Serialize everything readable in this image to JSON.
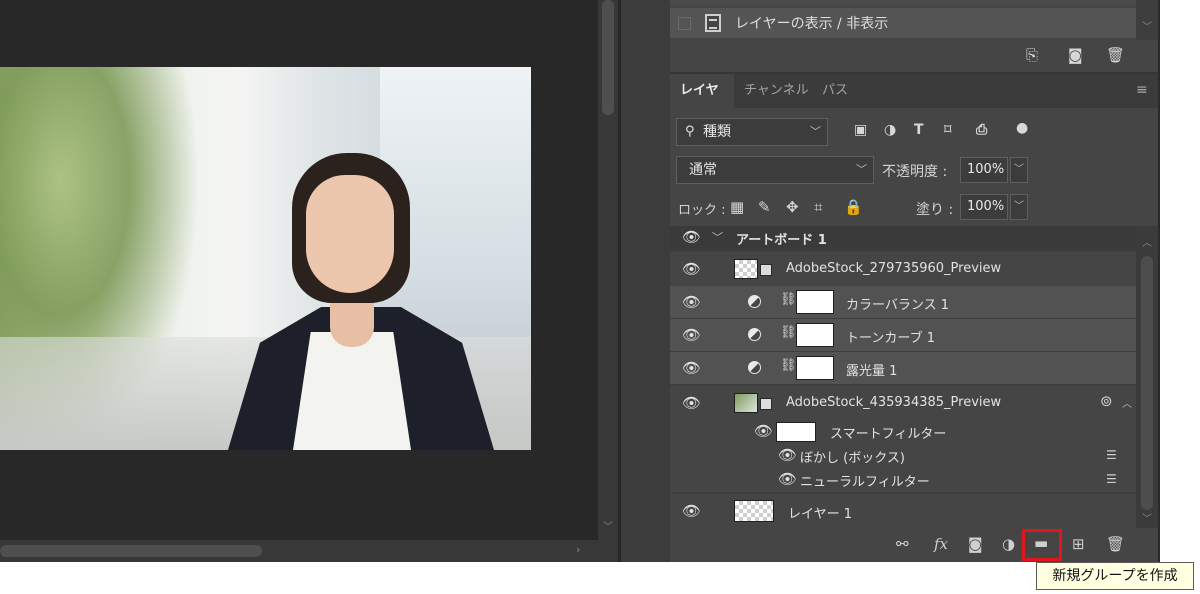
{
  "history": {
    "step_label": "レイヤーの表示 / 非表示"
  },
  "panel_tabs": [
    {
      "label": "レイヤー",
      "active": true
    },
    {
      "label": "チャンネル",
      "active": false
    },
    {
      "label": "パス",
      "active": false
    }
  ],
  "filter": {
    "kind_label": "種類"
  },
  "blend": {
    "mode": "通常",
    "opacity_label": "不透明度 :",
    "opacity_value": "100%"
  },
  "lock": {
    "label": "ロック :",
    "fill_label": "塗り :",
    "fill_value": "100%"
  },
  "layers": {
    "artboard": "アートボード 1",
    "stock1": "AdobeStock_279735960_Preview",
    "color_balance": "カラーバランス 1",
    "tone_curve": "トーンカーブ 1",
    "exposure": "露光量 1",
    "stock2": "AdobeStock_435934385_Preview",
    "smart_filter": "スマートフィルター",
    "blur_box": "ぼかし (ボックス)",
    "neural_filter": "ニューラルフィルター",
    "layer1": "レイヤー 1"
  },
  "tooltip": "新規グループを作成",
  "colors": {
    "highlight": "#e3141b",
    "panel_bg": "#454545",
    "canvas_bg": "#282828"
  }
}
